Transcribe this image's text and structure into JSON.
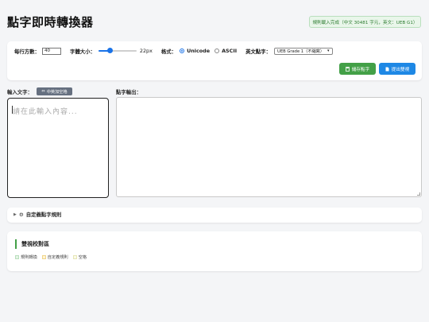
{
  "app": {
    "title": "點字即時轉換器",
    "status": "規則載入完成（中文 30481 字元，英文：UEB G1）"
  },
  "settings": {
    "cells_per_line_label": "每行方數：",
    "cells_per_line_value": "40",
    "font_size_label": "字體大小：",
    "font_size_value": "22px",
    "font_size_slider_fraction": 0.3,
    "format_label": "格式：",
    "format_options": [
      "Unicode",
      "ASCII"
    ],
    "format_selected": "Unicode",
    "english_braille_label": "英文點字：",
    "english_braille_selected": "UEB Grade 1（不縮寫）",
    "save_button": "儲存點字",
    "submit_button": "提出雙視",
    "save_icon": "save-icon",
    "doc_icon": "document-icon"
  },
  "input": {
    "label": "輸入文字：",
    "toggle_button": "中英加空格",
    "toggle_icon": "swap-arrows-icon",
    "placeholder": "請在此輸入內容..."
  },
  "output": {
    "label": "點字輸出："
  },
  "custom_rules": {
    "label": "自定義點字規則",
    "icon": "gear-icon"
  },
  "proofread": {
    "title": "雙視校對區",
    "legend": [
      {
        "label": "規則轉換",
        "color": "#e6f4e6"
      },
      {
        "label": "自定義規則",
        "color": "#fff4d6"
      },
      {
        "label": "空格",
        "color": "#fbfbe8"
      }
    ]
  },
  "colors": {
    "accent_blue": "#1e88e5",
    "accent_green": "#43a047",
    "status_bg": "#e9f6ea"
  }
}
